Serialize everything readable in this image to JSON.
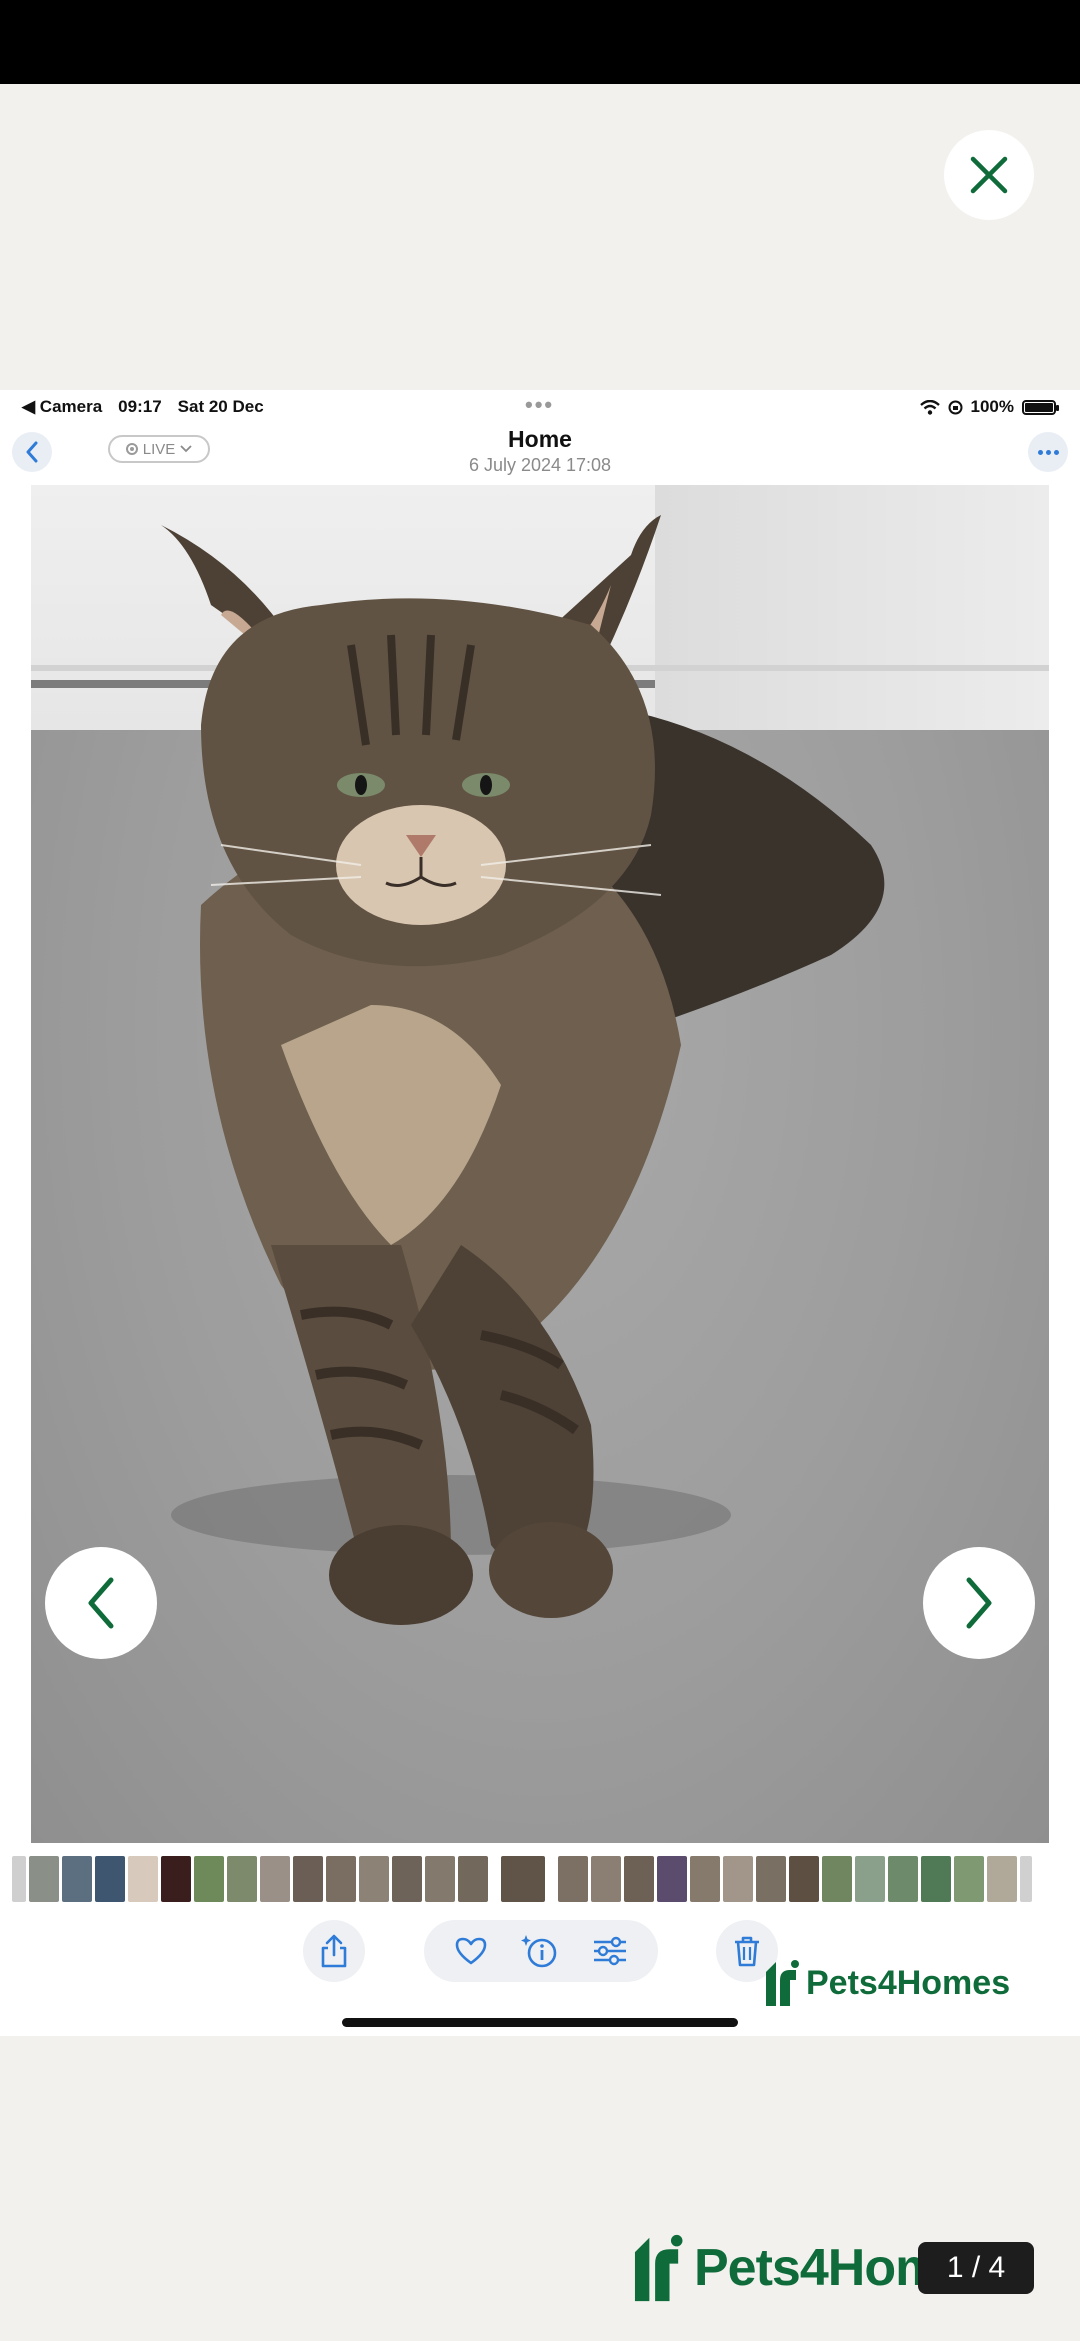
{
  "viewer": {
    "counter": "1 / 4",
    "brand": "Pets4Homes"
  },
  "screenshot": {
    "status": {
      "back_app": "Camera",
      "time": "09:17",
      "date": "Sat 20 Dec",
      "battery": "100%"
    },
    "nav": {
      "live_label": "LIVE",
      "title": "Home",
      "subtitle": "6 July 2024  17:08"
    },
    "toolbar": {
      "actions": [
        "share",
        "favorite",
        "info",
        "adjust",
        "delete"
      ]
    },
    "brand": "Pets4Homes"
  },
  "colors": {
    "brand_green": "#0f6b3a",
    "ios_blue": "#2f7bd8",
    "background": "#f2f1ed"
  }
}
